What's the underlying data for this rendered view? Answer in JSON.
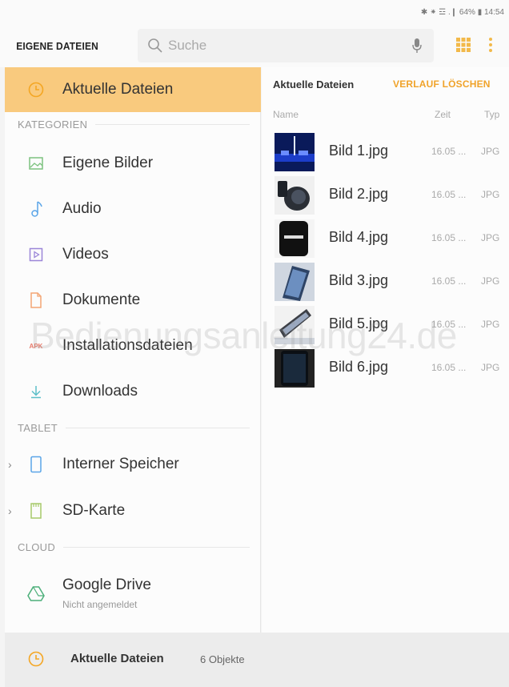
{
  "statusbar": {
    "text": "✱ ⁕ ☲ .❙ 64% ▮ 14:54"
  },
  "header": {
    "app_title": "EIGENE DATEIEN",
    "search_placeholder": "Suche"
  },
  "sidebar": {
    "active": {
      "label": "Aktuelle Dateien",
      "icon": "clock-icon"
    },
    "section_categories": "KATEGORIEN",
    "categories": [
      {
        "label": "Eigene Bilder",
        "icon": "image-icon"
      },
      {
        "label": "Audio",
        "icon": "music-note-icon"
      },
      {
        "label": "Videos",
        "icon": "video-icon"
      },
      {
        "label": "Dokumente",
        "icon": "document-icon"
      },
      {
        "label": "Installationsdateien",
        "icon": "apk-icon",
        "icon_text": "APK"
      },
      {
        "label": "Downloads",
        "icon": "download-icon"
      }
    ],
    "section_tablet": "TABLET",
    "tablet": [
      {
        "label": "Interner Speicher",
        "icon": "phone-icon"
      },
      {
        "label": "SD-Karte",
        "icon": "sd-card-icon"
      }
    ],
    "section_cloud": "CLOUD",
    "cloud": [
      {
        "label": "Google Drive",
        "sub": "Nicht angemeldet",
        "icon": "google-drive-icon"
      }
    ]
  },
  "main": {
    "title": "Aktuelle Dateien",
    "clear_label": "VERLAUF LÖSCHEN",
    "columns": {
      "name": "Name",
      "time": "Zeit",
      "type": "Typ"
    },
    "files": [
      {
        "name": "Bild 1.jpg",
        "time": "16.05 ...",
        "type": "JPG"
      },
      {
        "name": "Bild 2.jpg",
        "time": "16.05 ...",
        "type": "JPG"
      },
      {
        "name": "Bild 4.jpg",
        "time": "16.05 ...",
        "type": "JPG"
      },
      {
        "name": "Bild 3.jpg",
        "time": "16.05 ...",
        "type": "JPG"
      },
      {
        "name": "Bild 5.jpg",
        "time": "16.05 ...",
        "type": "JPG"
      },
      {
        "name": "Bild 6.jpg",
        "time": "16.05 ...",
        "type": "JPG"
      }
    ]
  },
  "watermark": "Bedienungsanleitung24.de",
  "bottombar": {
    "label": "Aktuelle Dateien",
    "count": "6 Objekte"
  },
  "colors": {
    "accent": "#f9ca7e",
    "accent_text": "#f0a32a"
  }
}
